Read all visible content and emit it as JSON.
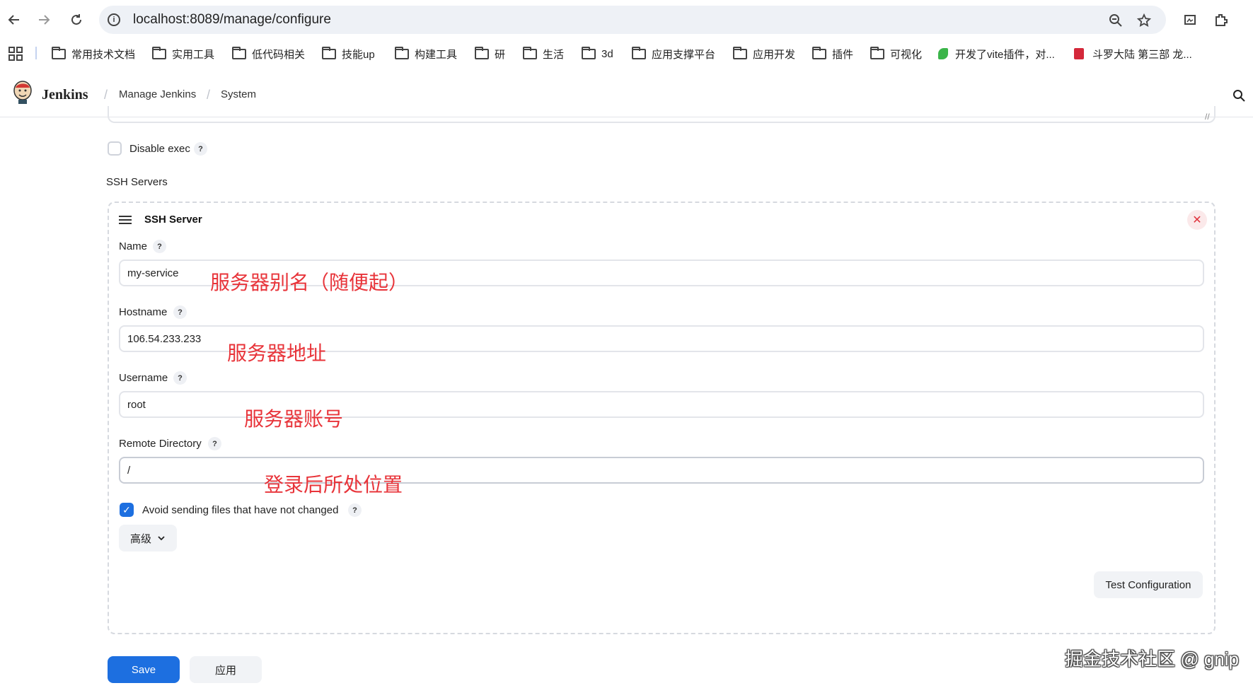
{
  "browser": {
    "url": "localhost:8089/manage/configure",
    "bookmarks": [
      {
        "label": "常用技术文档",
        "type": "folder"
      },
      {
        "label": "实用工具",
        "type": "folder"
      },
      {
        "label": "低代码相关",
        "type": "folder"
      },
      {
        "label": "技能up",
        "type": "folder"
      },
      {
        "label": "构建工具",
        "type": "folder"
      },
      {
        "label": "研",
        "type": "folder"
      },
      {
        "label": "生活",
        "type": "folder"
      },
      {
        "label": "3d",
        "type": "folder"
      },
      {
        "label": "应用支撑平台",
        "type": "folder"
      },
      {
        "label": "应用开发",
        "type": "folder"
      },
      {
        "label": "插件",
        "type": "folder"
      },
      {
        "label": "可视化",
        "type": "folder"
      },
      {
        "label": "开发了vite插件，对...",
        "type": "link",
        "icon": "leaf-icon"
      },
      {
        "label": "斗罗大陆 第三部 龙...",
        "type": "link",
        "icon": "book-icon"
      }
    ]
  },
  "header": {
    "app_name": "Jenkins",
    "breadcrumbs": [
      "Manage Jenkins",
      "System"
    ]
  },
  "form": {
    "disable_exec": {
      "label": "Disable exec",
      "checked": false
    },
    "ssh_servers_label": "SSH Servers",
    "ssh_server": {
      "title": "SSH Server",
      "name": {
        "label": "Name",
        "value": "my-service",
        "annotation": "服务器别名（随便起）"
      },
      "hostname": {
        "label": "Hostname",
        "value": "106.54.233.233",
        "annotation": "服务器地址"
      },
      "username": {
        "label": "Username",
        "value": "root",
        "annotation": "服务器账号"
      },
      "remote_directory": {
        "label": "Remote Directory",
        "value": "/",
        "annotation": "登录后所处位置"
      },
      "avoid_sending": {
        "label": "Avoid sending files that have not changed",
        "checked": true
      },
      "advanced_label": "高级",
      "test_config_label": "Test Configuration"
    },
    "help_glyph": "?"
  },
  "footer": {
    "save_label": "Save",
    "apply_label": "应用"
  },
  "watermark": "掘金技术社区 @ gnip",
  "colors": {
    "primary": "#1d6fe0",
    "annotation": "#e8343a",
    "close": "#e0323c"
  }
}
